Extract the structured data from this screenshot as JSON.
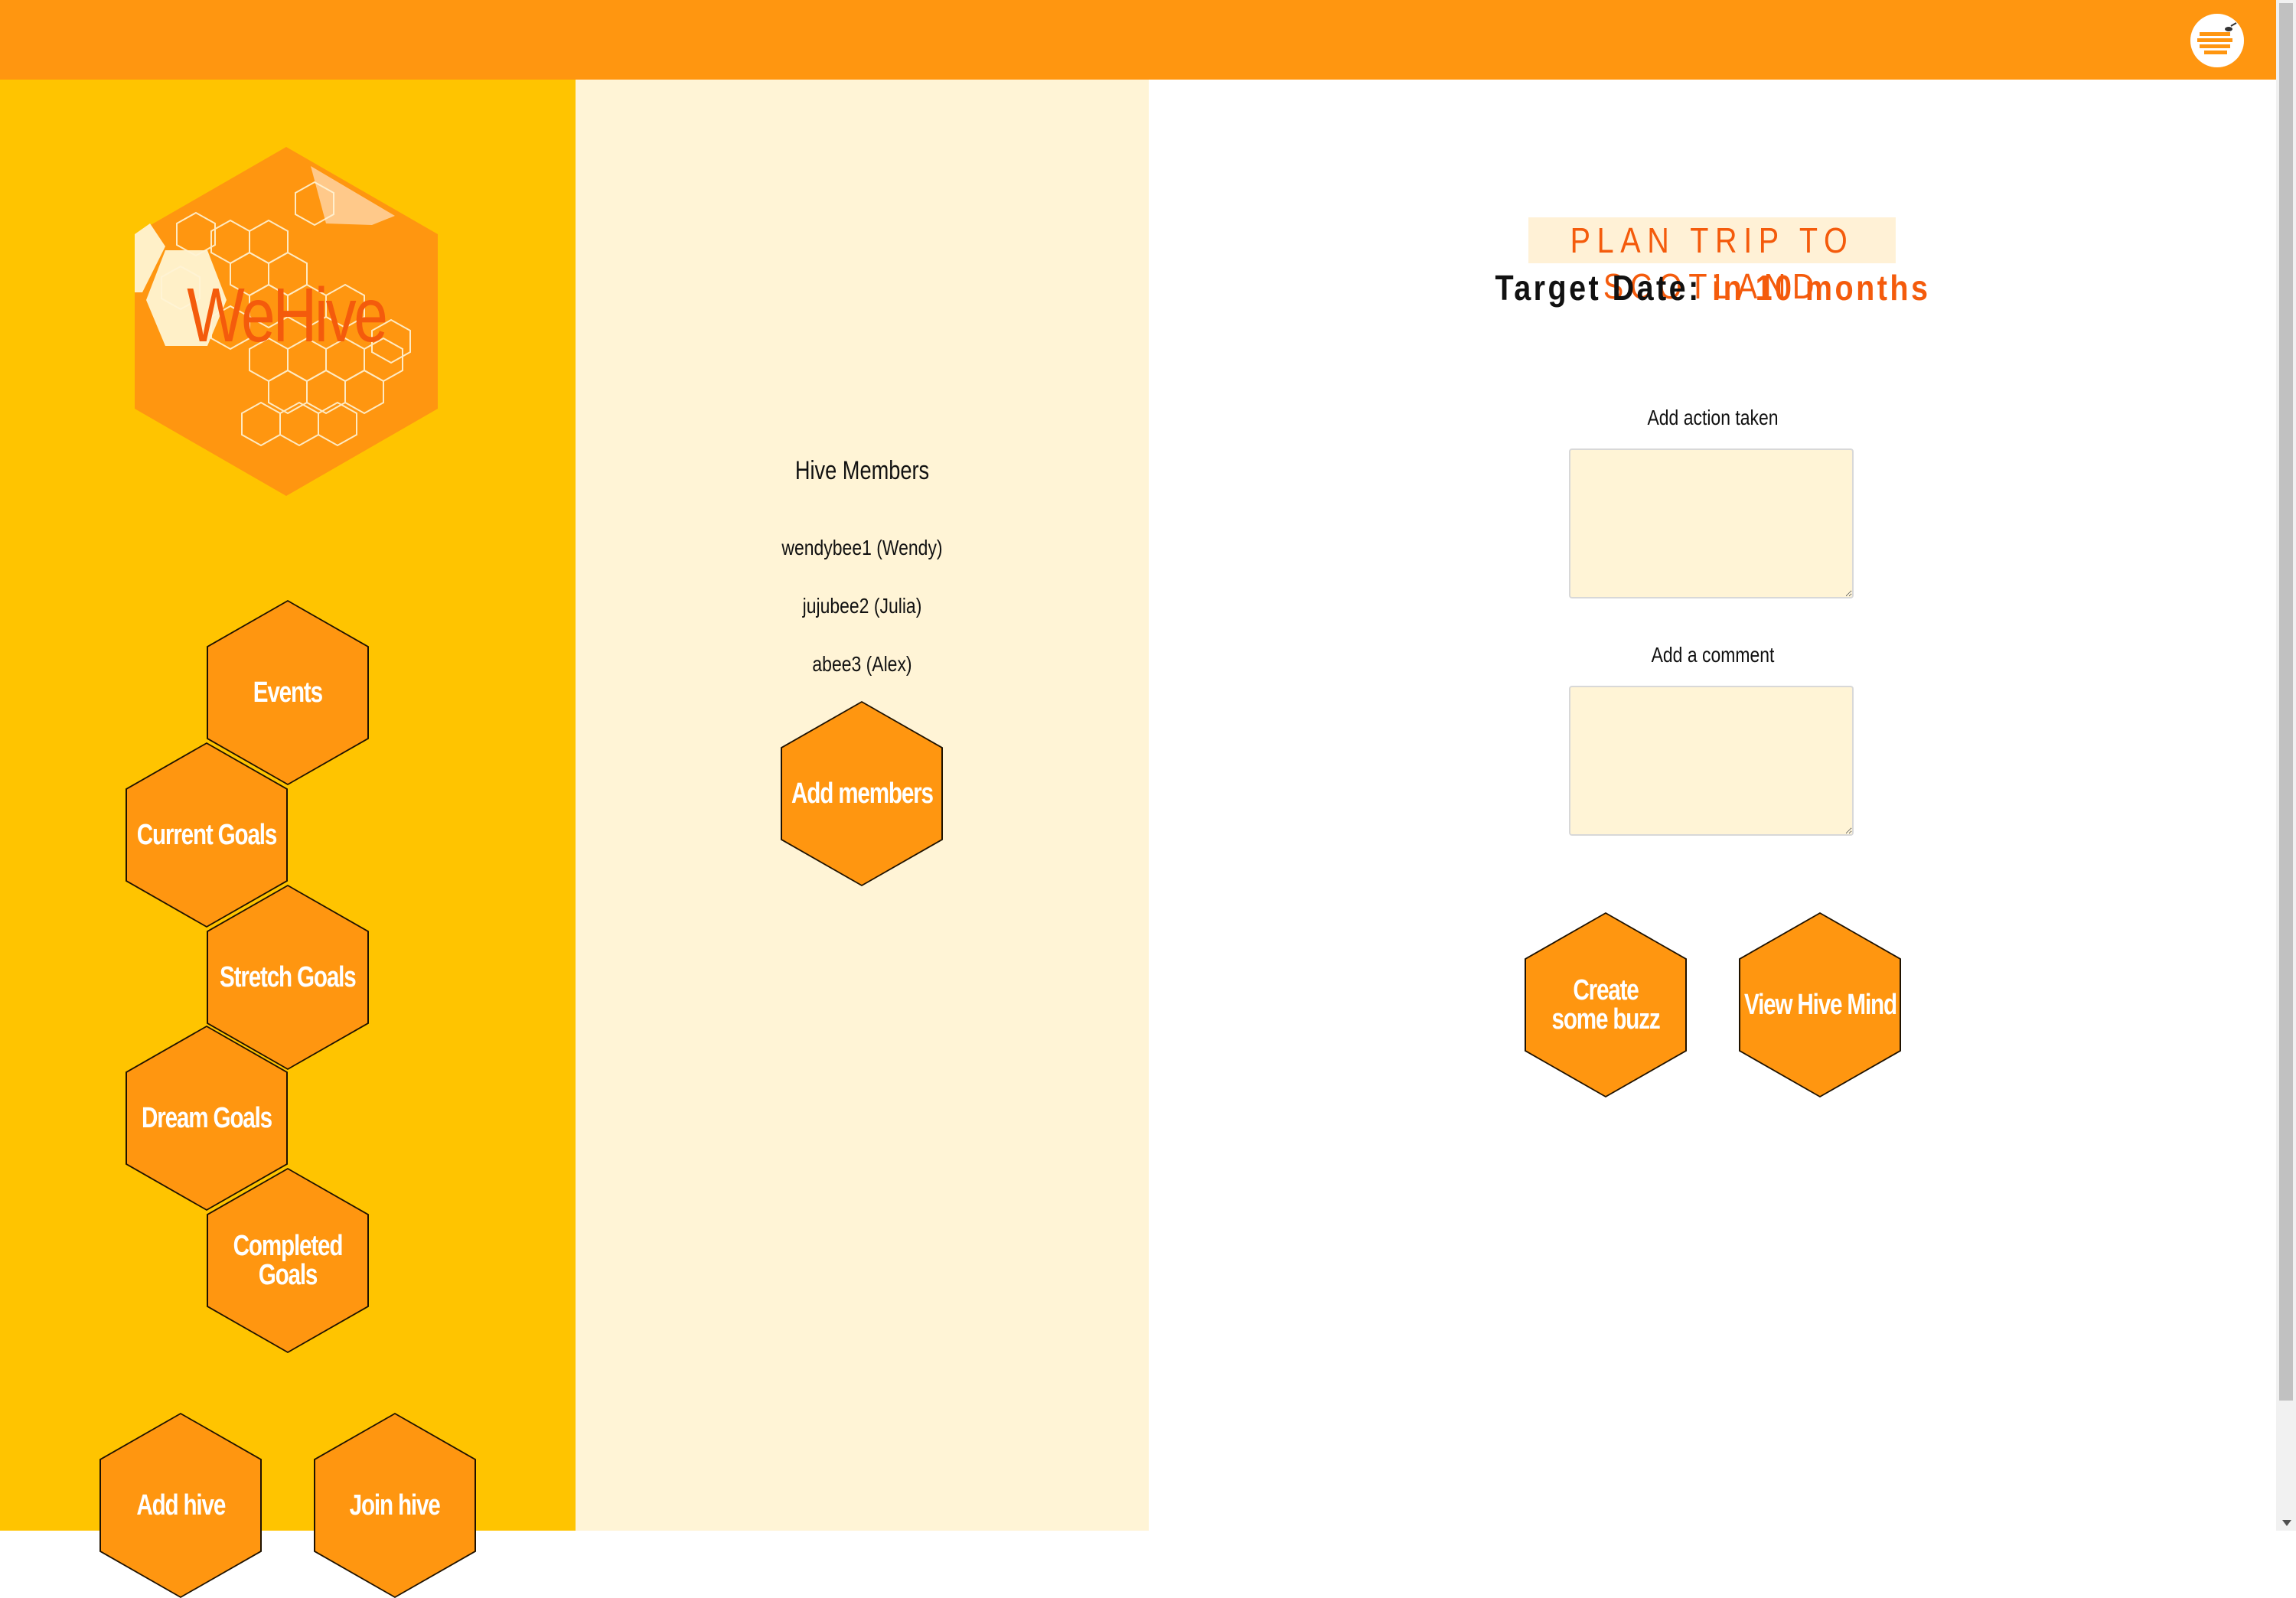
{
  "app": {
    "name": "WeHive"
  },
  "header": {
    "avatar_icon": "hive-avatar-icon"
  },
  "sidebar": {
    "nav": {
      "events": "Events",
      "current_goals": "Current Goals",
      "stretch_goals": "Stretch Goals",
      "dream_goals": "Dream Goals",
      "completed_goals": "Completed Goals"
    },
    "actions": {
      "add_hive": "Add hive",
      "join_hive": "Join hive"
    }
  },
  "members": {
    "title": "Hive Members",
    "list": [
      "wendybee1 (Wendy)",
      "jujubee2 (Julia)",
      "abee3 (Alex)"
    ],
    "add_button": "Add members"
  },
  "goal": {
    "title": "PLAN TRIP TO SCOTLAND",
    "target_label": "Target Date:",
    "target_value": "in 10 months"
  },
  "form": {
    "action_label": "Add action taken",
    "action_value": "",
    "comment_label": "Add a comment",
    "comment_value": ""
  },
  "buttons": {
    "create_buzz": "Create some buzz",
    "view_hive_mind": "View Hive Mind"
  },
  "colors": {
    "header": "#ff9610",
    "sidebar": "#ffc400",
    "middle": "#fff4d6",
    "accent": "#f45b0c",
    "hex_fill": "#ff9610"
  }
}
